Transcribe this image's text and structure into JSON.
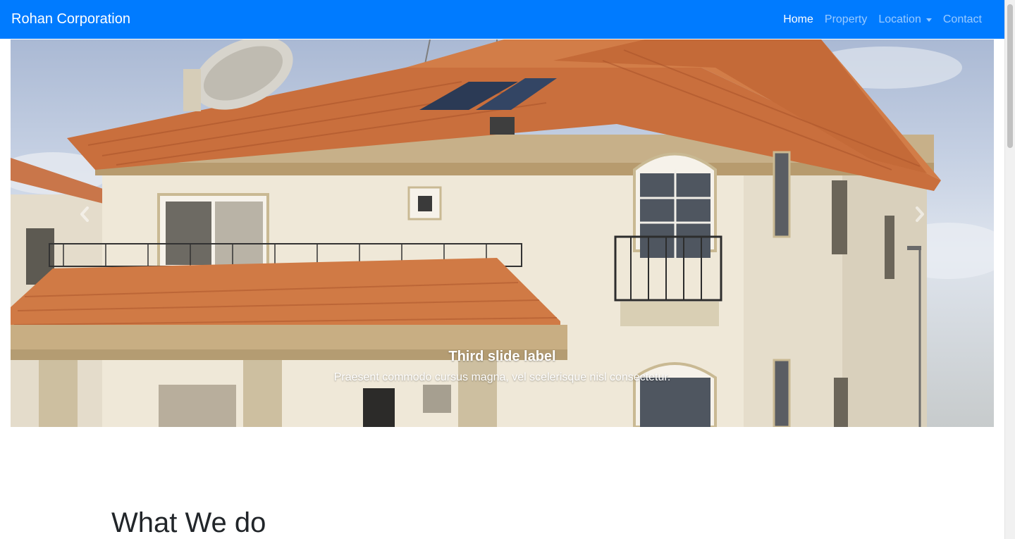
{
  "navbar": {
    "brand": "Rohan Corporation",
    "links": [
      {
        "label": "Home",
        "active": true
      },
      {
        "label": "Property",
        "active": false
      },
      {
        "label": "Location",
        "active": false,
        "dropdown": true
      },
      {
        "label": "Contact",
        "active": false
      }
    ],
    "color": "#007bff"
  },
  "carousel": {
    "caption_title": "Third slide label",
    "caption_text": "Praesent commodo cursus magna, vel scelerisque nisl consectetur.",
    "prev_icon": "chevron-left-icon",
    "next_icon": "chevron-right-icon"
  },
  "section": {
    "title": "What We do"
  }
}
